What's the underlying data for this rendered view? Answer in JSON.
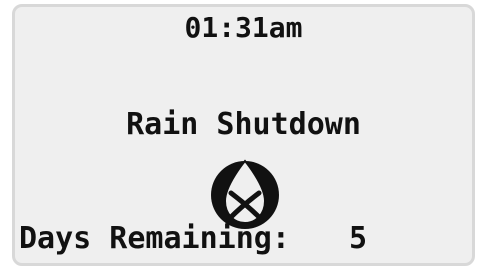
{
  "display": {
    "time": "01:31am",
    "status_title": "Rain Shutdown",
    "days_remaining_label": "Days Remaining:",
    "days_remaining_value": "5"
  },
  "icons": {
    "status_icon": "rain-drop-crossed-icon"
  },
  "colors": {
    "lcd_background": "#efefef",
    "lcd_text": "#111111",
    "bezel": "#d8d8d8"
  }
}
